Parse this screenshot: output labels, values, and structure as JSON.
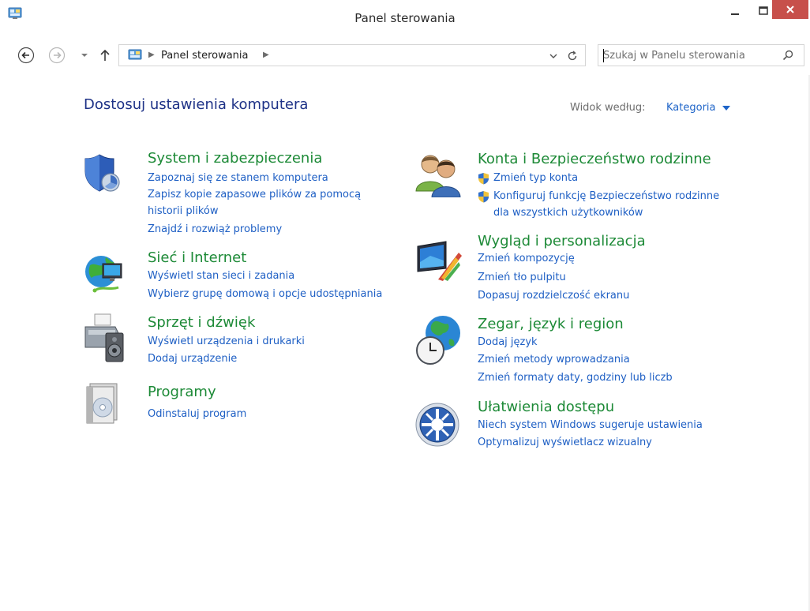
{
  "window": {
    "title": "Panel sterowania",
    "controls": [
      "minimize",
      "maximize",
      "close"
    ]
  },
  "nav": {
    "back_icon": "back-arrow-icon",
    "forward_icon": "forward-arrow-icon",
    "recent_icon": "dropdown-arrow-icon",
    "up_icon": "up-arrow-icon",
    "breadcrumb": [
      "Panel sterowania"
    ],
    "search_placeholder": "Szukaj w Panelu sterowania"
  },
  "header": {
    "title": "Dostosuj ustawienia komputera",
    "view_by_label": "Widok według:",
    "view_by_value": "Kategoria"
  },
  "categories_left": [
    {
      "title": "System i zabezpieczenia",
      "icon": "system-security-icon",
      "links": [
        "Zapoznaj się ze stanem komputera",
        "Zapisz kopie zapasowe plików za pomocą",
        "historii plików",
        "Znajdź i rozwiąż problemy"
      ]
    },
    {
      "title": "Sieć i Internet",
      "icon": "network-icon",
      "links": [
        "Wyświetl stan sieci i zadania",
        "Wybierz grupę domową i opcje udostępniania"
      ]
    },
    {
      "title": "Sprzęt i dźwięk",
      "icon": "hardware-sound-icon",
      "links": [
        "Wyświetl urządzenia i drukarki",
        "Dodaj urządzenie"
      ]
    },
    {
      "title": "Programy",
      "icon": "programs-icon",
      "links": [
        "Odinstaluj program"
      ]
    }
  ],
  "categories_right": [
    {
      "title": "Konta i Bezpieczeństwo rodzinne",
      "icon": "user-accounts-icon",
      "links": [
        "Zmień typ konta",
        "Konfiguruj funkcję Bezpieczeństwo rodzinne",
        "dla wszystkich użytkowników"
      ]
    },
    {
      "title": "Wygląd i personalizacja",
      "icon": "appearance-icon",
      "links": [
        "Zmień kompozycję",
        "Zmień tło pulpitu",
        "Dopasuj rozdzielczość ekranu"
      ]
    },
    {
      "title": "Zegar, język i region",
      "icon": "clock-globe-icon",
      "links": [
        "Dodaj język",
        "Zmień metody wprowadzania",
        "Zmień formaty daty, godziny lub liczb"
      ]
    },
    {
      "title": "Ułatwienia dostępu",
      "icon": "ease-of-access-icon",
      "links": [
        "Niech system Windows sugeruje ustawienia",
        "Optymalizuj wyświetlacz wizualny"
      ]
    }
  ],
  "colors": {
    "category_title": "#1d8a37",
    "link": "#1e5fc4",
    "heading": "#1e3287",
    "close_button": "#c7504b"
  }
}
